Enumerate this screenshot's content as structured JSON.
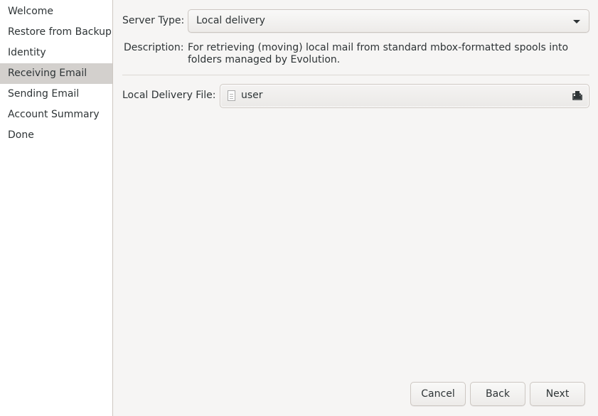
{
  "sidebar": {
    "items": [
      {
        "label": "Welcome",
        "active": false
      },
      {
        "label": "Restore from Backup",
        "active": false
      },
      {
        "label": "Identity",
        "active": false
      },
      {
        "label": "Receiving Email",
        "active": true
      },
      {
        "label": "Sending Email",
        "active": false
      },
      {
        "label": "Account Summary",
        "active": false
      },
      {
        "label": "Done",
        "active": false
      }
    ]
  },
  "form": {
    "server_type_label": "Server Type:",
    "server_type_value": "Local delivery",
    "description_label": "Description:",
    "description_text": "For retrieving (moving) local mail from standard mbox-formatted spools into folders managed by Evolution.",
    "local_delivery_file_label": "Local Delivery File:",
    "local_delivery_file_value": "user",
    "file_icon": "document-icon",
    "open_icon": "document-open-icon"
  },
  "buttons": {
    "cancel": "Cancel",
    "back": "Back",
    "next": "Next"
  },
  "colors": {
    "sidebar_active": "#d3d0cd",
    "window_bg": "#f6f5f4",
    "sidebar_bg": "#ffffff"
  }
}
